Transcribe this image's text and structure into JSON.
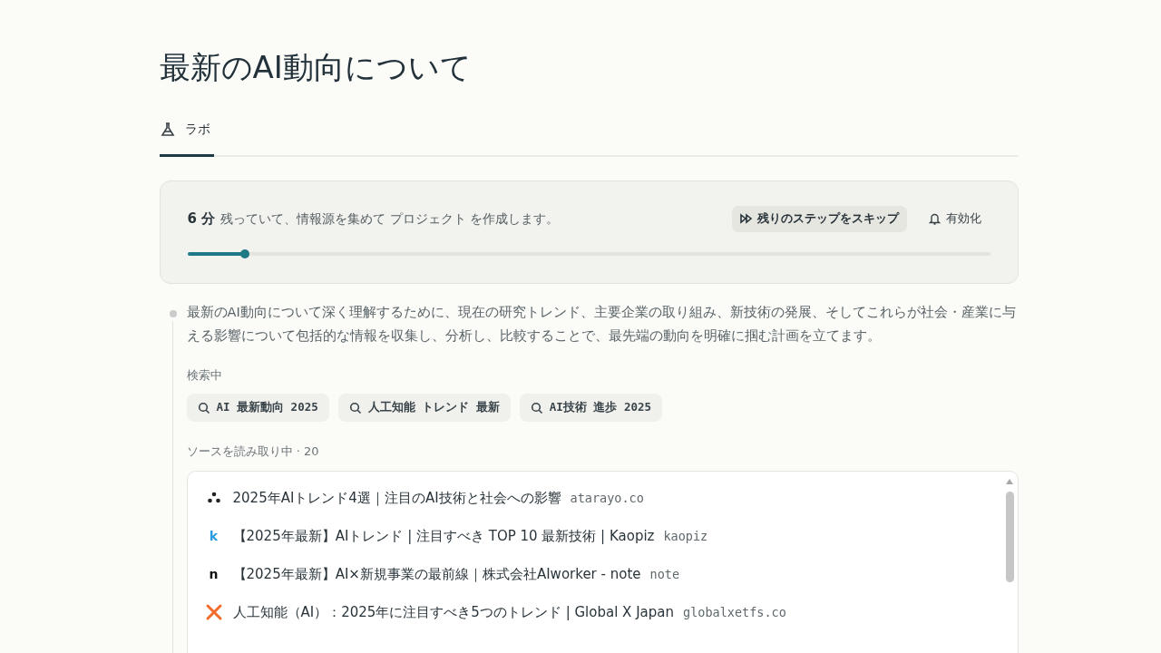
{
  "title": "最新のAI動向について",
  "tabs": [
    {
      "label": "ラボ",
      "selected": true
    }
  ],
  "status": {
    "minutes": "6 分",
    "message": "残っていて、情報源を集めて プロジェクト を作成します。",
    "skip_button": "残りのステップをスキップ",
    "enable_button": "有効化",
    "level": 0.072
  },
  "plan": "最新のAI動向について深く理解するために、現在の研究トレンド、主要企業の取り組み、新技術の発展、そしてこれらが社会・産業に与える影響について包括的な情報を収集し、分析し、比較することで、最先端の動向を明確に掴む計画を立てます。",
  "searching": {
    "label": "検索中",
    "queries": [
      "AI 最新動向 2025",
      "人工知能 トレンド 最新",
      "AI技術 進歩 2025"
    ]
  },
  "sources": {
    "label": "ソースを読み取り中 · 20",
    "items": [
      {
        "kind": "dots",
        "title": "2025年AIトレンド4選｜注目のAI技術と社会への影響",
        "domain": "atarayo.co"
      },
      {
        "kind": "letter",
        "logo": "k",
        "color": "#2a9be0",
        "title": "【2025年最新】AIトレンド | 注目すべき TOP 10 最新技術 | Kaopiz",
        "domain": "kaopiz"
      },
      {
        "kind": "letter",
        "logo": "n",
        "color": "#111111",
        "title": "【2025年最新】AI×新規事業の最前線｜株式会社AIworker - note",
        "domain": "note"
      },
      {
        "kind": "cross",
        "title": "人工知能（AI）：2025年に注目すべき5つのトレンド | Global X Japan",
        "domain": "globalxetfs.co"
      }
    ]
  }
}
